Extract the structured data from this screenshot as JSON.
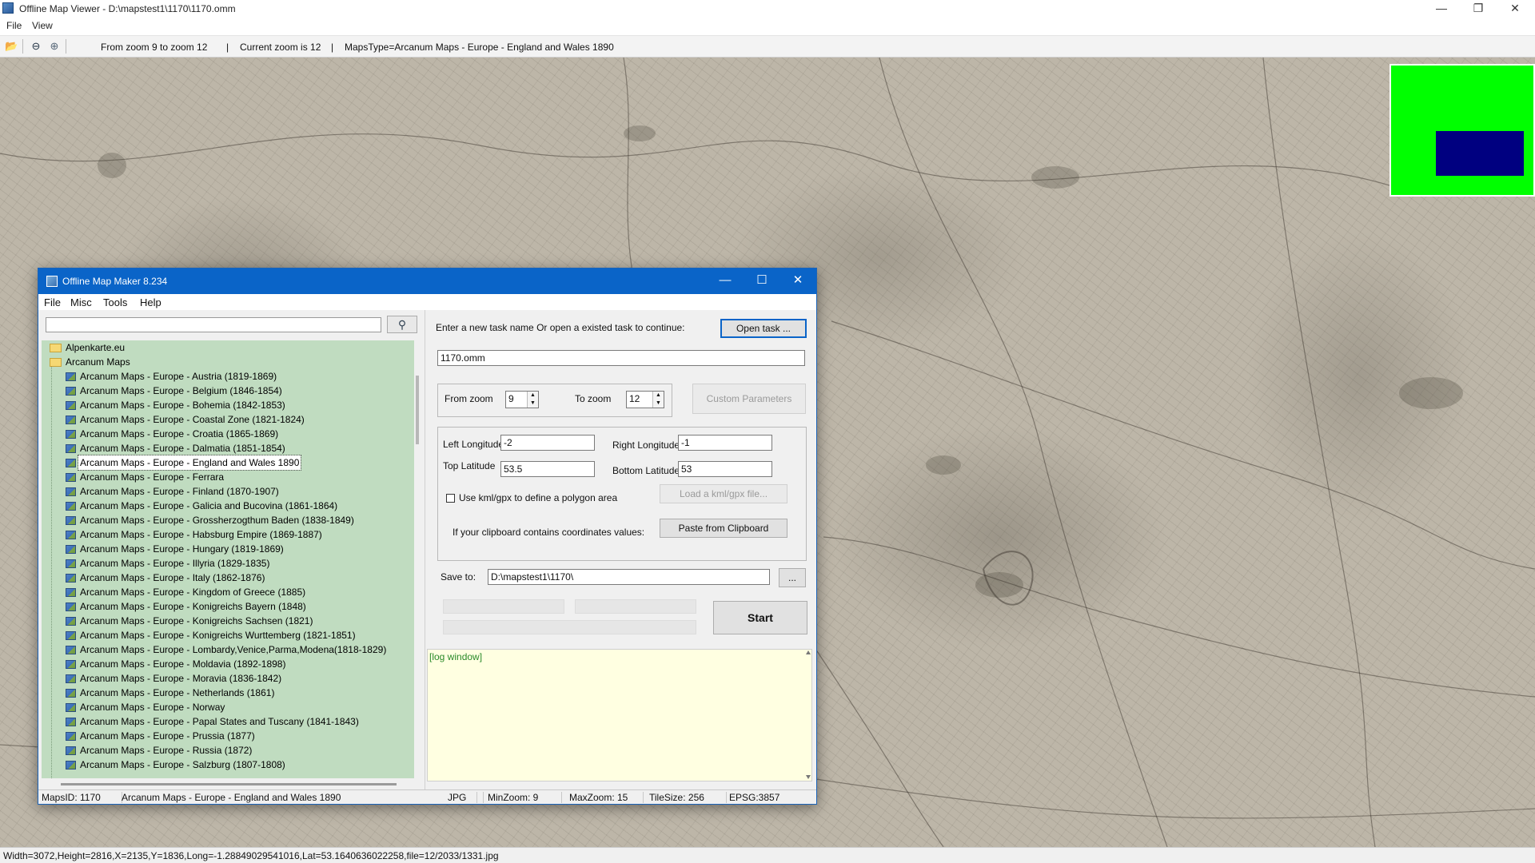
{
  "window": {
    "title": "Offline Map Viewer - D:\\mapstest1\\1170\\1170.omm",
    "controls": {
      "minimize": "—",
      "restore": "❐",
      "close": "✕"
    }
  },
  "menu": {
    "file": "File",
    "view": "View"
  },
  "toolbar": {
    "icons": [
      "open-folder-icon",
      "zoom-out-icon",
      "zoom-in-icon"
    ],
    "zoom_range": "From zoom 9 to zoom 12",
    "current_zoom": "Current zoom is 12",
    "maps_type": "MapsType=Arcanum Maps - Europe - England and Wales 1890",
    "divider": "|"
  },
  "minimap": {
    "background_color": "#00ff00",
    "viewport_color": "#000080"
  },
  "status_bar": "Width=3072,Height=2816,X=2135,Y=1836,Long=-1.28849029541016,Lat=53.1640636022258,file=12/2033/1331.jpg",
  "dialog": {
    "title": "Offline Map Maker 8.234",
    "controls": {
      "minimize": "—",
      "maximize": "☐",
      "close": "✕"
    },
    "menu": [
      "File",
      "Misc",
      "Tools",
      "Help"
    ],
    "search": {
      "value": "",
      "button_icon": "search-icon"
    },
    "tree": {
      "folders": [
        "Alpenkarte.eu",
        "Arcanum Maps"
      ],
      "items": [
        "Arcanum Maps - Europe - Austria (1819-1869)",
        "Arcanum Maps - Europe - Belgium (1846-1854)",
        "Arcanum Maps - Europe - Bohemia (1842-1853)",
        "Arcanum Maps - Europe - Coastal Zone (1821-1824)",
        "Arcanum Maps - Europe - Croatia (1865-1869)",
        "Arcanum Maps - Europe - Dalmatia (1851-1854)",
        "Arcanum Maps - Europe - England and Wales 1890",
        "Arcanum Maps - Europe - Ferrara",
        "Arcanum Maps - Europe - Finland (1870-1907)",
        "Arcanum Maps - Europe - Galicia and Bucovina (1861-1864)",
        "Arcanum Maps - Europe - Grossherzogthum Baden (1838-1849)",
        "Arcanum Maps - Europe - Habsburg Empire (1869-1887)",
        "Arcanum Maps - Europe - Hungary (1819-1869)",
        "Arcanum Maps - Europe - Illyria (1829-1835)",
        "Arcanum Maps - Europe - Italy (1862-1876)",
        "Arcanum Maps - Europe - Kingdom of Greece (1885)",
        "Arcanum Maps - Europe - Konigreichs Bayern (1848)",
        "Arcanum Maps - Europe - Konigreichs Sachsen (1821)",
        "Arcanum Maps - Europe - Konigreichs Wurttemberg (1821-1851)",
        "Arcanum Maps - Europe - Lombardy,Venice,Parma,Modena(1818-1829)",
        "Arcanum Maps - Europe - Moldavia (1892-1898)",
        "Arcanum Maps - Europe - Moravia (1836-1842)",
        "Arcanum Maps - Europe - Netherlands (1861)",
        "Arcanum Maps - Europe - Norway",
        "Arcanum Maps - Europe - Papal States and Tuscany (1841-1843)",
        "Arcanum Maps - Europe - Prussia (1877)",
        "Arcanum Maps - Europe - Russia (1872)",
        "Arcanum Maps - Europe - Salzburg (1807-1808)"
      ],
      "selected": "Arcanum Maps - Europe - England and Wales 1890"
    },
    "task_prompt": "Enter a new task name Or open a existed task to continue:",
    "open_task_button": "Open task ...",
    "task_name": "1170.omm",
    "from_zoom_label": "From zoom",
    "from_zoom_value": "9",
    "to_zoom_label": "To zoom",
    "to_zoom_value": "12",
    "custom_parameters_button": "Custom Parameters",
    "left_longitude_label": "Left Longitude",
    "left_longitude_value": "-2",
    "right_longitude_label": "Right Longitude",
    "right_longitude_value": "-1",
    "top_latitude_label": "Top Latitude",
    "top_latitude_value": "53.5",
    "bottom_latitude_label": "Bottom Latitude",
    "bottom_latitude_value": "53",
    "use_kml_label": "Use kml/gpx to define a polygon area",
    "use_kml_checked": false,
    "load_kml_button": "Load a kml/gpx file...",
    "clipboard_label": "If your clipboard contains coordinates values:",
    "paste_button": "Paste from Clipboard",
    "save_to_label": "Save to:",
    "save_to_value": "D:\\mapstest1\\1170\\",
    "browse_button": "...",
    "start_button": "Start",
    "log_text": "[log window]",
    "status": {
      "maps_id": "MapsID: 1170",
      "map_name": "Arcanum Maps - Europe - England and Wales 1890",
      "format": "JPG",
      "min_zoom": "MinZoom: 9",
      "max_zoom": "MaxZoom: 15",
      "tile_size": "TileSize: 256",
      "epsg": "EPSG:3857"
    }
  }
}
